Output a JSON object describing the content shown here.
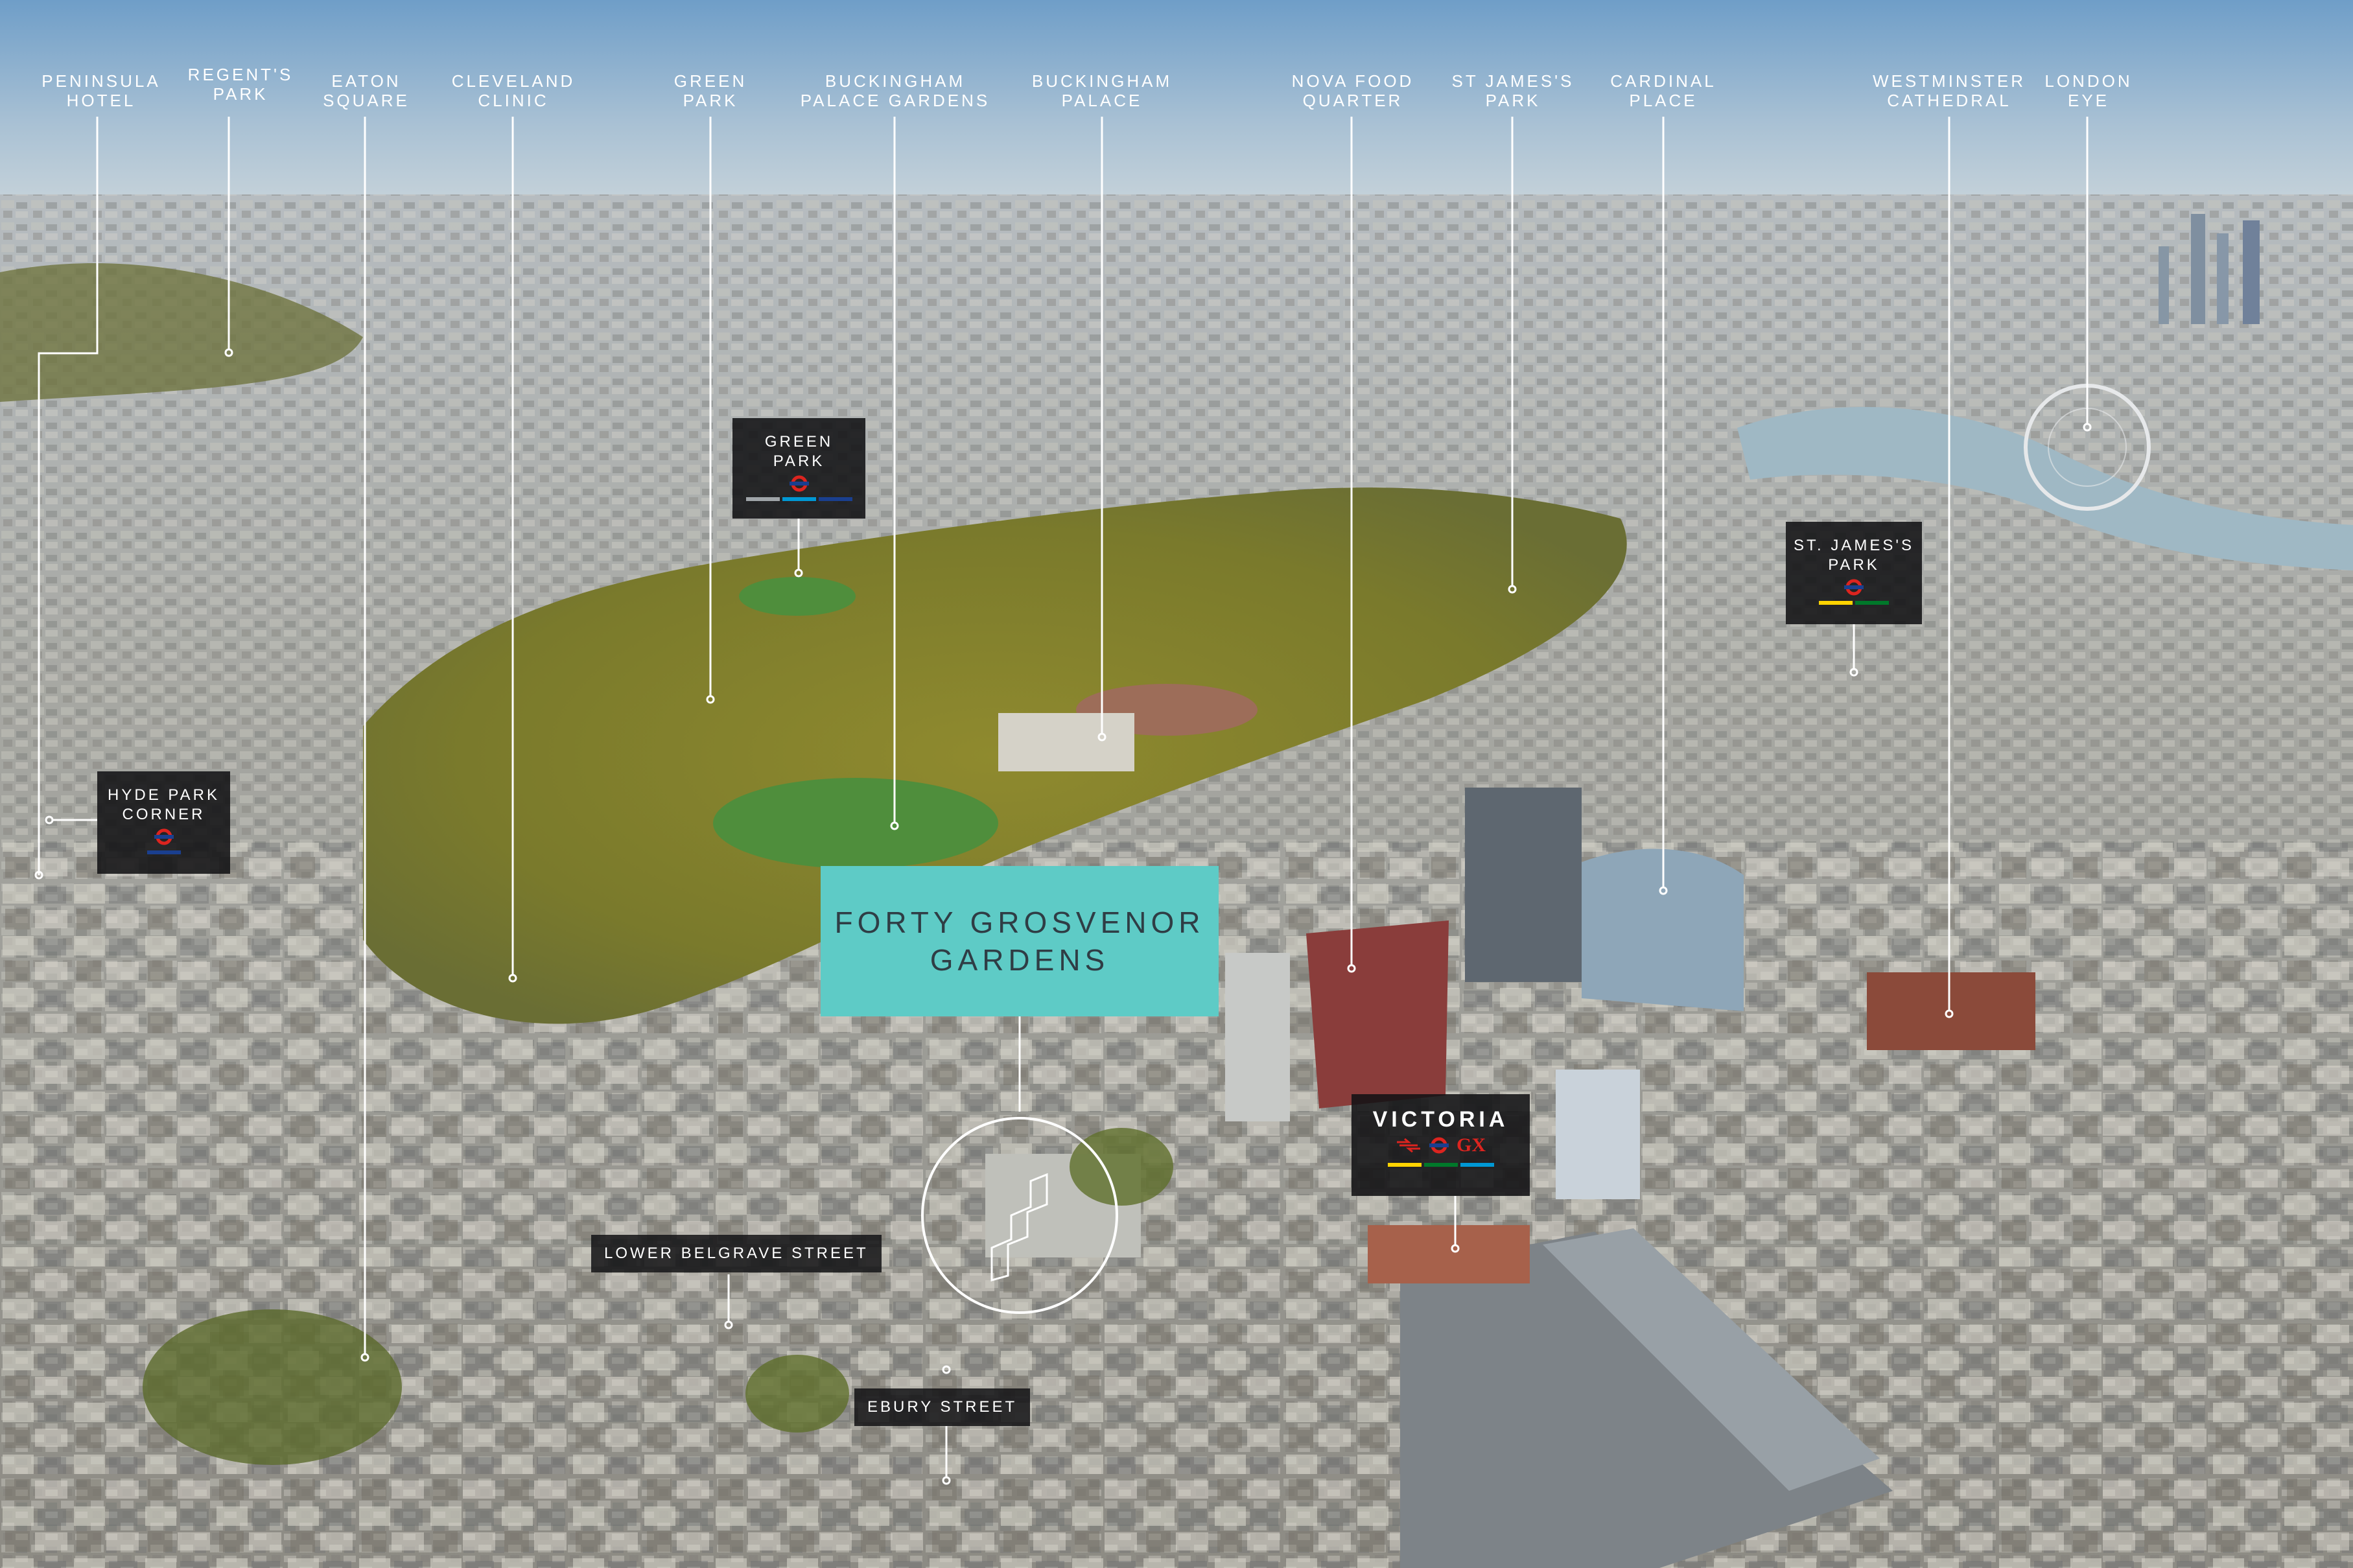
{
  "colors": {
    "sky_top": "#6f9ec8",
    "sky_horizon": "#c7d3da",
    "park_green": "#8a8a36",
    "lawn_green": "#4f8e3c",
    "city_tone": "#aeb0ad",
    "river": "#9fb8c4",
    "hero_teal": "#5ecbc6",
    "hero_text": "#2f3d45",
    "badge_bg": "#121214",
    "leader_line": "#ffffff",
    "tube_red": "#dc241f",
    "tube_blue": "#1a3f8f",
    "line_grey": "#a0a5a9",
    "line_lightblue": "#0098d4",
    "line_yellow": "#ffd300",
    "line_green": "#00782a"
  },
  "landmarks": [
    {
      "id": "peninsula-hotel",
      "label": "PENINSULA\nHOTEL"
    },
    {
      "id": "regents-park",
      "label": "REGENT'S\nPARK"
    },
    {
      "id": "eaton-square",
      "label": "EATON\nSQUARE"
    },
    {
      "id": "cleveland-clinic",
      "label": "CLEVELAND\nCLINIC"
    },
    {
      "id": "green-park",
      "label": "GREEN\nPARK"
    },
    {
      "id": "buckingham-palace-gardens",
      "label": "BUCKINGHAM\nPALACE GARDENS"
    },
    {
      "id": "buckingham-palace",
      "label": "BUCKINGHAM\nPALACE"
    },
    {
      "id": "nova-food-quarter",
      "label": "NOVA FOOD\nQUARTER"
    },
    {
      "id": "st-jamess-park",
      "label": "ST JAMES'S\nPARK"
    },
    {
      "id": "cardinal-place",
      "label": "CARDINAL\nPLACE"
    },
    {
      "id": "westminster-cathedral",
      "label": "WESTMINSTER\nCATHEDRAL"
    },
    {
      "id": "london-eye",
      "label": "LONDON\nEYE"
    }
  ],
  "stations": [
    {
      "id": "green-park-station",
      "label": "GREEN\nPARK",
      "icon": "underground-roundel-icon"
    },
    {
      "id": "st-jamess-park-station",
      "label": "ST. JAMES'S\nPARK",
      "icon": "underground-roundel-icon"
    },
    {
      "id": "hyde-park-corner-station",
      "label": "HYDE PARK\nCORNER",
      "icon": "underground-roundel-icon"
    },
    {
      "id": "victoria-station",
      "label": "VICTORIA",
      "icons": [
        "national-rail-icon",
        "underground-roundel-icon",
        "gatwick-express-icon"
      ],
      "gx_text": "GX"
    }
  ],
  "streets": [
    {
      "id": "lower-belgrave-street",
      "label": "LOWER BELGRAVE STREET"
    },
    {
      "id": "ebury-street",
      "label": "EBURY STREET"
    }
  ],
  "development": {
    "label": "FORTY GROSVENOR\nGARDENS",
    "marker_icon": "site-outline-icon"
  }
}
